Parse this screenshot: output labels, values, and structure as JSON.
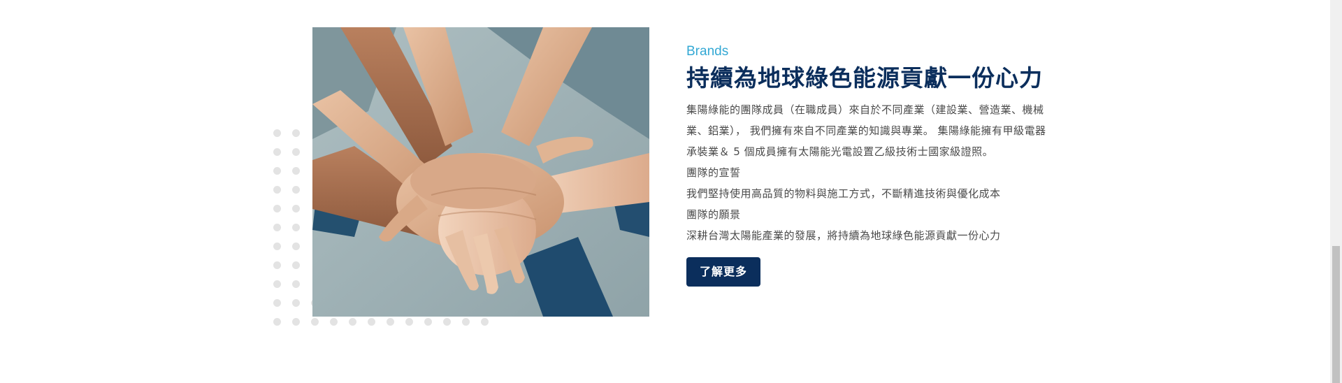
{
  "section": {
    "eyebrow": "Brands",
    "title": "持續為地球綠色能源貢獻一份心力",
    "paragraphs": [
      "集陽綠能的團隊成員（在職成員）來自於不同產業（建設業、營造業、機械業、鋁業）， 我們擁有來自不同產業的知識與專業。 集陽綠能擁有甲級電器承裝業＆ 5 個成員擁有太陽能光電設置乙級技術士國家級證照。",
      "團隊的宣誓",
      "我們堅持使用高品質的物料與施工方式，不斷精進技術與優化成本",
      "團隊的願景",
      "深耕台灣太陽能產業的發展，將持續為地球綠色能源貢獻一份心力"
    ],
    "button_label": "了解更多",
    "image": "team-hands-stacked-photo"
  },
  "colors": {
    "accent": "#33a8d4",
    "brand": "#0b2e5c",
    "dots": "#e3e3e3"
  }
}
